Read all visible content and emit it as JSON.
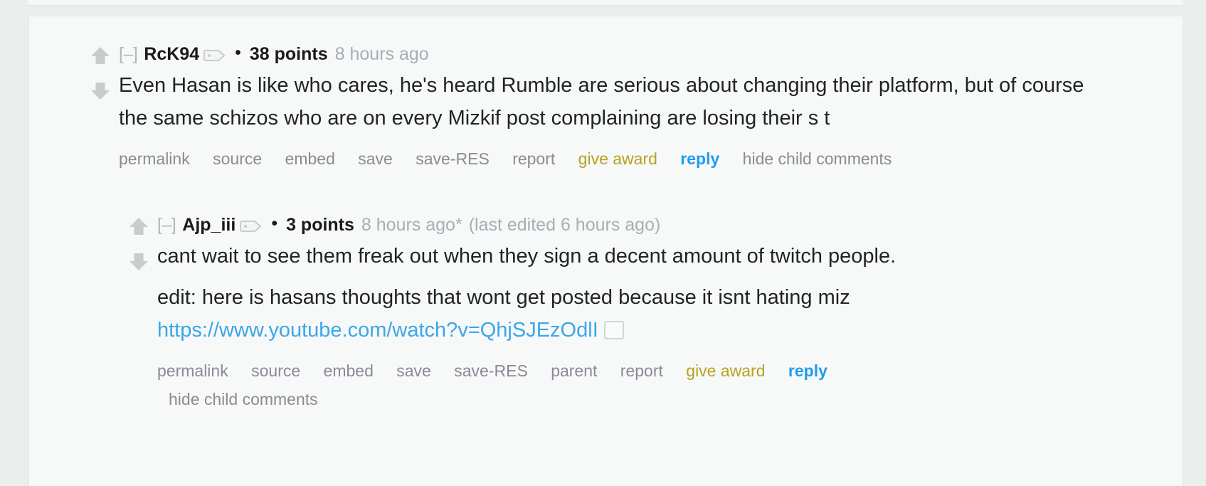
{
  "comments": [
    {
      "collapse_toggle": "[–]",
      "username": "RcK94",
      "tag_icon": "user-tag-icon",
      "separator": "•",
      "points": "38 points",
      "timeago": "8 hours ago",
      "edited": "",
      "body_lines": [
        "Even Hasan is like who cares, he's heard Rumble are serious about changing their platform, but of course the same schizos who are on every Mizkif post complaining are losing their s   t"
      ],
      "actions": [
        {
          "label": "permalink",
          "style": "default"
        },
        {
          "label": "source",
          "style": "default"
        },
        {
          "label": "embed",
          "style": "default"
        },
        {
          "label": "save",
          "style": "default"
        },
        {
          "label": "save-RES",
          "style": "default"
        },
        {
          "label": "report",
          "style": "default"
        },
        {
          "label": "give award",
          "style": "award"
        },
        {
          "label": "reply",
          "style": "reply"
        },
        {
          "label": "hide child comments",
          "style": "default"
        }
      ]
    },
    {
      "collapse_toggle": "[–]",
      "username": "Ajp_iii",
      "tag_icon": "user-tag-icon",
      "separator": "•",
      "points": "3 points",
      "timeago": "8 hours ago*",
      "edited": "(last edited 6 hours ago)",
      "body_lines": [
        "cant wait to see them freak out when they sign a decent amount of twitch people.",
        "edit: here is hasans thoughts that wont get posted because it isnt hating miz"
      ],
      "link_url": "https://www.youtube.com/watch?v=QhjSJEzOdlI",
      "actions_line1": [
        {
          "label": "permalink",
          "style": "default"
        },
        {
          "label": "source",
          "style": "default"
        },
        {
          "label": "embed",
          "style": "default"
        },
        {
          "label": "save",
          "style": "default"
        },
        {
          "label": "save-RES",
          "style": "default"
        },
        {
          "label": "parent",
          "style": "default"
        },
        {
          "label": "report",
          "style": "default"
        },
        {
          "label": "give award",
          "style": "award"
        },
        {
          "label": "reply",
          "style": "reply"
        }
      ],
      "actions_line2": [
        {
          "label": "hide child comments",
          "style": "default"
        }
      ]
    }
  ],
  "colors": {
    "page_background": "#eceded",
    "panel_background": "#f7f8f8",
    "text": "#222326",
    "muted": "#a7aeb5",
    "action": "#8b8a96",
    "award": "#b5a222",
    "reply": "#1f9cf0",
    "link": "#3ba7e8",
    "arrow": "#c9cbcd"
  }
}
